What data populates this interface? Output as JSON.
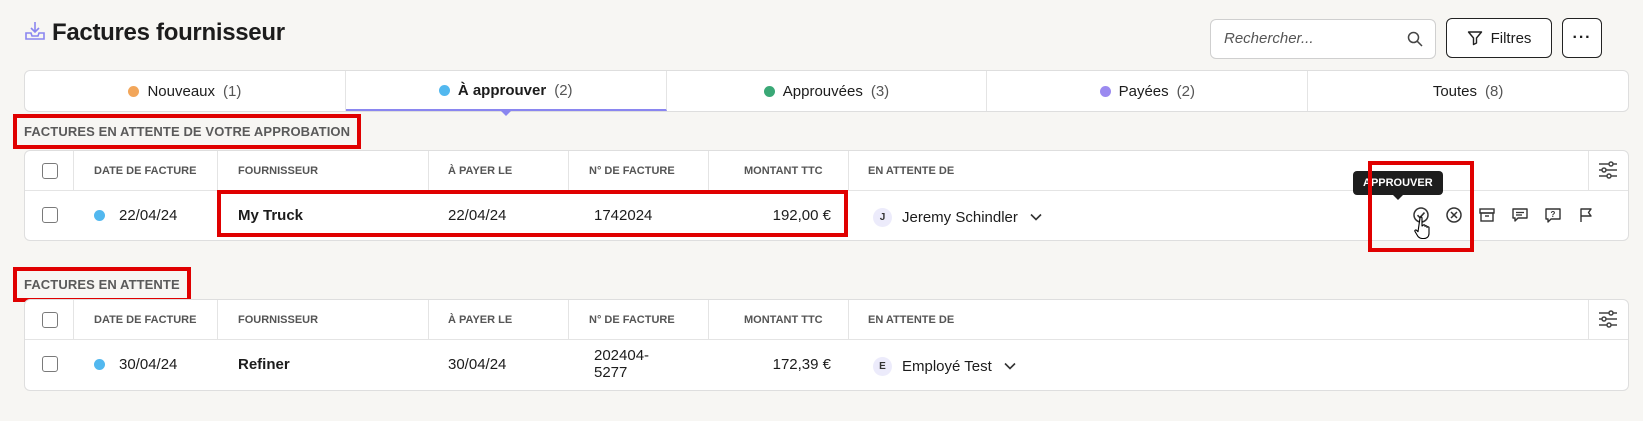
{
  "page": {
    "title": "Factures fournisseur",
    "search_placeholder": "Rechercher...",
    "filter_label": "Filtres",
    "more_label": "···"
  },
  "tabs": [
    {
      "label": "Nouveaux",
      "count": "(1)",
      "dot_color": "#f2a65a"
    },
    {
      "label": "À approuver",
      "count": "(2)",
      "dot_color": "#52b8ef"
    },
    {
      "label": "Approuvées",
      "count": "(3)",
      "dot_color": "#3aa876"
    },
    {
      "label": "Payées",
      "count": "(2)",
      "dot_color": "#9b8af0"
    },
    {
      "label": "Toutes",
      "count": "(8)"
    }
  ],
  "sections": [
    {
      "label": "FACTURES EN ATTENTE DE VOTRE APPROBATION",
      "columns": [
        "DATE DE FACTURE",
        "FOURNISSEUR",
        "À PAYER LE",
        "N° DE FACTURE",
        "MONTANT TTC",
        "EN ATTENTE DE"
      ],
      "rows": [
        {
          "date": "22/04/24",
          "supplier": "My Truck",
          "due": "22/04/24",
          "number": "1742024",
          "amount": "192,00 €",
          "avatar": "J",
          "waiting": "Jeremy Schindler"
        }
      ]
    },
    {
      "label": "FACTURES EN ATTENTE",
      "columns": [
        "DATE DE FACTURE",
        "FOURNISSEUR",
        "À PAYER LE",
        "N° DE FACTURE",
        "MONTANT TTC",
        "EN ATTENTE DE"
      ],
      "rows": [
        {
          "date": "30/04/24",
          "supplier": "Refiner",
          "due": "30/04/24",
          "number_line1": "202404-",
          "number_line2": "5277",
          "amount": "172,39 €",
          "avatar": "E",
          "waiting": "Employé Test"
        }
      ]
    }
  ],
  "tooltip": "APPROUVER",
  "colors": {
    "accent": "#8a86f0",
    "highlight": "#e00000",
    "status_dot": "#52b8ef"
  }
}
